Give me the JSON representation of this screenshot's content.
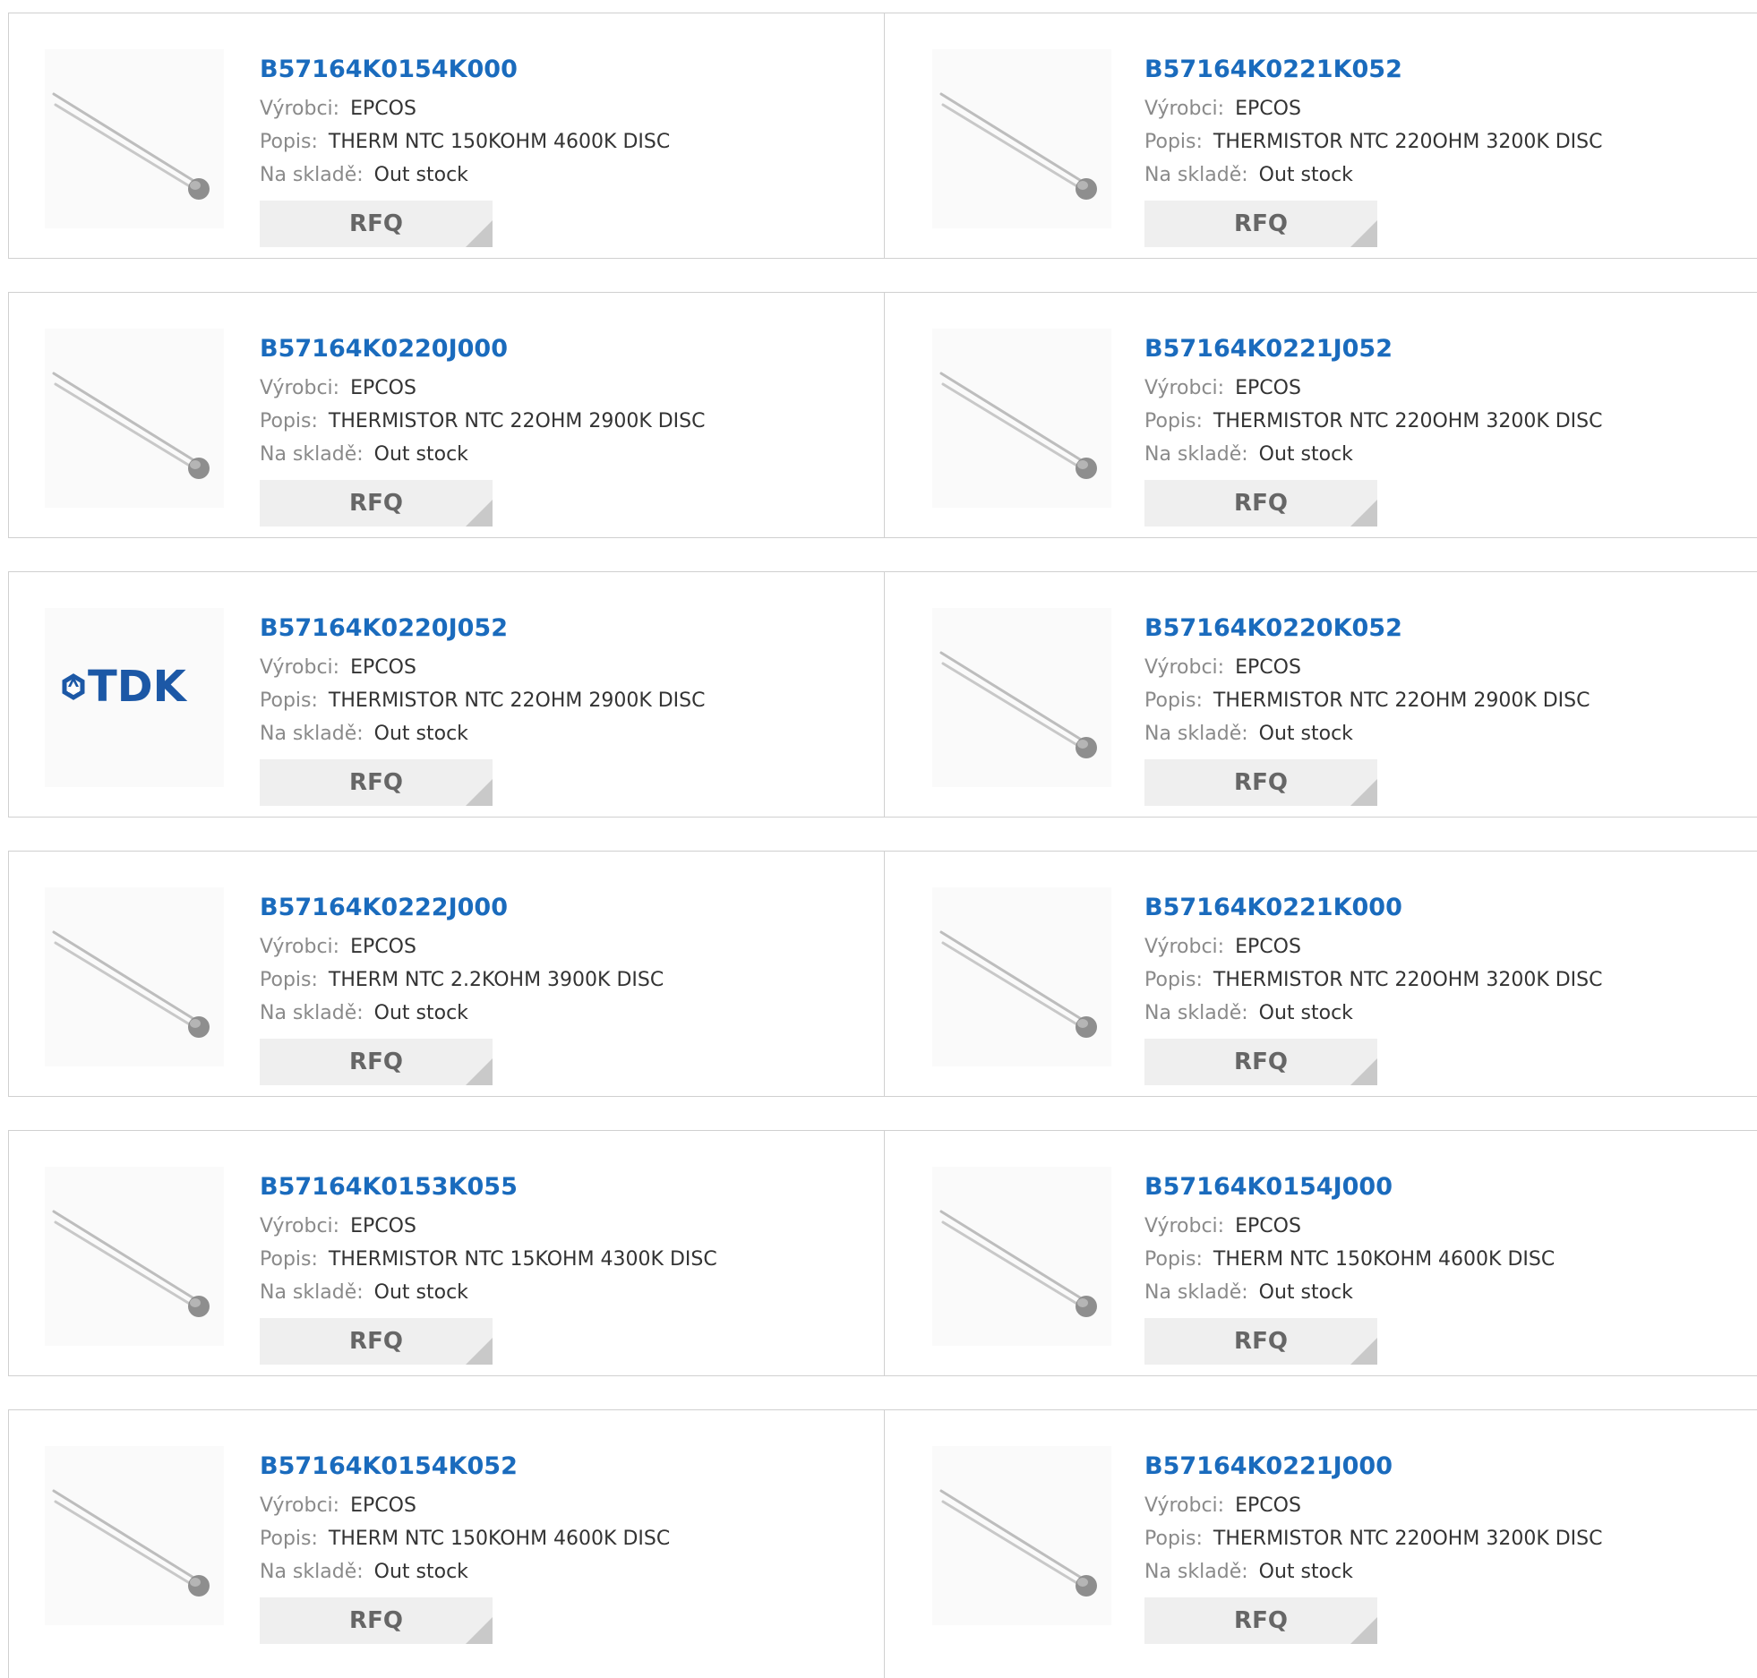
{
  "labels": {
    "manufacturer": "Výrobci:",
    "description": "Popis:",
    "stock": "Na skladě:",
    "rfq": "RFQ"
  },
  "colors": {
    "part_link": "#1a6bbd",
    "button_bg": "#efefef",
    "button_text": "#666666",
    "tdk_logo": "#1c58a6"
  },
  "products": [
    {
      "part": "B57164K0154K000",
      "manufacturer": "EPCOS",
      "description": "THERM NTC 150KOHM 4600K DISC",
      "stock": "Out stock",
      "image": "thermistor-photo"
    },
    {
      "part": "B57164K0221K052",
      "manufacturer": "EPCOS",
      "description": "THERMISTOR NTC 220OHM 3200K DISC",
      "stock": "Out stock",
      "image": "thermistor-photo"
    },
    {
      "part": "B57164K0220J000",
      "manufacturer": "EPCOS",
      "description": "THERMISTOR NTC 22OHM 2900K DISC",
      "stock": "Out stock",
      "image": "thermistor-photo"
    },
    {
      "part": "B57164K0221J052",
      "manufacturer": "EPCOS",
      "description": "THERMISTOR NTC 220OHM 3200K DISC",
      "stock": "Out stock",
      "image": "thermistor-photo"
    },
    {
      "part": "B57164K0220J052",
      "manufacturer": "EPCOS",
      "description": "THERMISTOR NTC 22OHM 2900K DISC",
      "stock": "Out stock",
      "image": "tdk-logo",
      "logo_text": "TDK"
    },
    {
      "part": "B57164K0220K052",
      "manufacturer": "EPCOS",
      "description": "THERMISTOR NTC 22OHM 2900K DISC",
      "stock": "Out stock",
      "image": "thermistor-photo"
    },
    {
      "part": "B57164K0222J000",
      "manufacturer": "EPCOS",
      "description": "THERM NTC 2.2KOHM 3900K DISC",
      "stock": "Out stock",
      "image": "thermistor-photo"
    },
    {
      "part": "B57164K0221K000",
      "manufacturer": "EPCOS",
      "description": "THERMISTOR NTC 220OHM 3200K DISC",
      "stock": "Out stock",
      "image": "thermistor-photo"
    },
    {
      "part": "B57164K0153K055",
      "manufacturer": "EPCOS",
      "description": "THERMISTOR NTC 15KOHM 4300K DISC",
      "stock": "Out stock",
      "image": "thermistor-photo"
    },
    {
      "part": "B57164K0154J000",
      "manufacturer": "EPCOS",
      "description": "THERM NTC 150KOHM 4600K DISC",
      "stock": "Out stock",
      "image": "thermistor-photo"
    },
    {
      "part": "B57164K0154K052",
      "manufacturer": "EPCOS",
      "description": "THERM NTC 150KOHM 4600K DISC",
      "stock": "Out stock",
      "image": "thermistor-photo"
    },
    {
      "part": "B57164K0221J000",
      "manufacturer": "EPCOS",
      "description": "THERMISTOR NTC 220OHM 3200K DISC",
      "stock": "Out stock",
      "image": "thermistor-photo"
    }
  ]
}
